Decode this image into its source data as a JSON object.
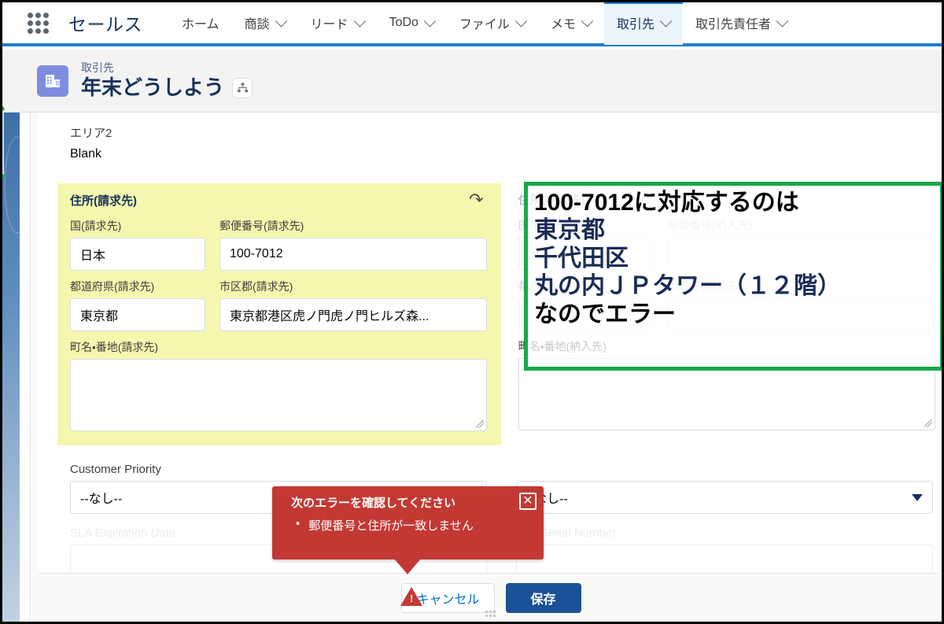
{
  "global_nav": {
    "app_name": "セールス",
    "waffle_icon": "app-launcher-icon",
    "tabs": [
      {
        "label": "ホーム",
        "has_menu": false,
        "active": false
      },
      {
        "label": "商談",
        "has_menu": true,
        "active": false
      },
      {
        "label": "リード",
        "has_menu": true,
        "active": false
      },
      {
        "label": "ToDo",
        "has_menu": true,
        "active": false
      },
      {
        "label": "ファイル",
        "has_menu": true,
        "active": false
      },
      {
        "label": "メモ",
        "has_menu": true,
        "active": false
      },
      {
        "label": "取引先",
        "has_menu": true,
        "active": true
      },
      {
        "label": "取引先責任者",
        "has_menu": true,
        "active": false
      }
    ]
  },
  "record_header": {
    "object_label": "取引先",
    "record_name": "年末どうしよう",
    "object_icon": "account-building-icon",
    "hierarchy_icon": "hierarchy-icon"
  },
  "form": {
    "static_fields": [
      {
        "label": "エリア2",
        "value": "Blank"
      }
    ],
    "billing": {
      "section_title": "住所(請求先)",
      "undo_icon": "undo-arrow-icon",
      "country_label": "国(請求先)",
      "country_value": "日本",
      "postal_label": "郵便番号(請求先)",
      "postal_value": "100-7012",
      "state_label": "都道府県(請求先)",
      "state_value": "東京都",
      "city_label": "市区郡(請求先)",
      "city_value": "東京都港区虎ノ門虎ノ門ヒルズ森...",
      "street_label": "町名・番地(請求先)",
      "street_value": ""
    },
    "shipping": {
      "section_title": "住所(納入先)",
      "country_label": "国(納入先)",
      "country_value": "",
      "postal_label": "郵便番号(納入先)",
      "postal_value": "",
      "state_label": "都道府県(納入先)",
      "state_value": "",
      "city_label": "市区郡(納入先)",
      "city_value": "",
      "street_label": "町名・番地(納入先)",
      "street_value": ""
    },
    "lower_left": {
      "priority_label": "Customer Priority",
      "priority_value": "--なし--",
      "sla_label": "SLA Expiration Date",
      "sla_value": ""
    },
    "lower_right": {
      "picklist_value": "--なし--",
      "caret_icon": "chevron-down-icon",
      "serial_label": "SLA Serial Number",
      "serial_value": ""
    }
  },
  "annotation": {
    "line1": "100-7012に対応するのは",
    "line2": "東京都",
    "line3": "千代田区",
    "line4": "丸の内ＪＰタワー（１２階）",
    "line5": "なのでエラー",
    "border_color": "#17a84a"
  },
  "error_popover": {
    "title": "次のエラーを確認してください",
    "bullet": "•",
    "message": "郵便番号と住所が一致しません",
    "close_icon": "close-icon",
    "close_label": "✕",
    "background_color": "#c23934"
  },
  "footer": {
    "warning_icon": "warning-triangle-icon",
    "warning_glyph": "!",
    "cancel_label": "キャンセル",
    "save_label": "保存",
    "grip_icon": "resize-grip-icon"
  }
}
